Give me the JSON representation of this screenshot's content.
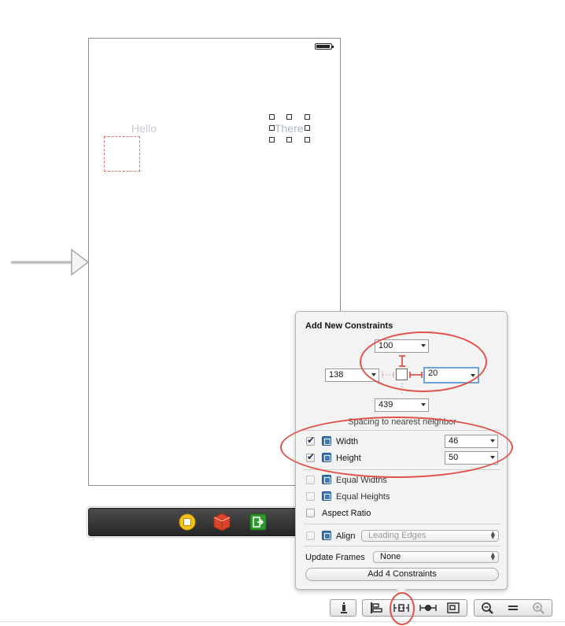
{
  "canvas": {
    "labels": {
      "hello": "Hello",
      "there": "There"
    }
  },
  "popover": {
    "title": "Add New Constraints",
    "top_value": "100",
    "left_value": "138",
    "right_value": "20",
    "bottom_value": "439",
    "spacing_label": "Spacing to nearest neighbor",
    "rows": {
      "width": {
        "label": "Width",
        "checked": true,
        "value": "46"
      },
      "height": {
        "label": "Height",
        "checked": true,
        "value": "50"
      },
      "equal_widths": {
        "label": "Equal Widths",
        "checked": false
      },
      "equal_heights": {
        "label": "Equal Heights",
        "checked": false
      },
      "aspect_ratio": {
        "label": "Aspect Ratio",
        "checked": false
      },
      "align": {
        "label": "Align",
        "checked": false,
        "value": "Leading Edges"
      }
    },
    "update_frames": {
      "label": "Update Frames",
      "value": "None"
    },
    "add_button": "Add 4 Constraints"
  },
  "dock": {
    "icons": [
      "view-controller-icon",
      "first-responder-icon",
      "exit-icon"
    ]
  },
  "toolbar": {
    "icons": [
      "issues-icon",
      "align-icon",
      "pin-icon",
      "resolve-issues-icon",
      "resizing-icon",
      "zoom-out-icon",
      "zoom-reset-icon",
      "zoom-in-icon"
    ]
  },
  "colors": {
    "annotation": "#e0524a",
    "focus": "#6fa2d8",
    "constraint_red": "#e07070"
  }
}
